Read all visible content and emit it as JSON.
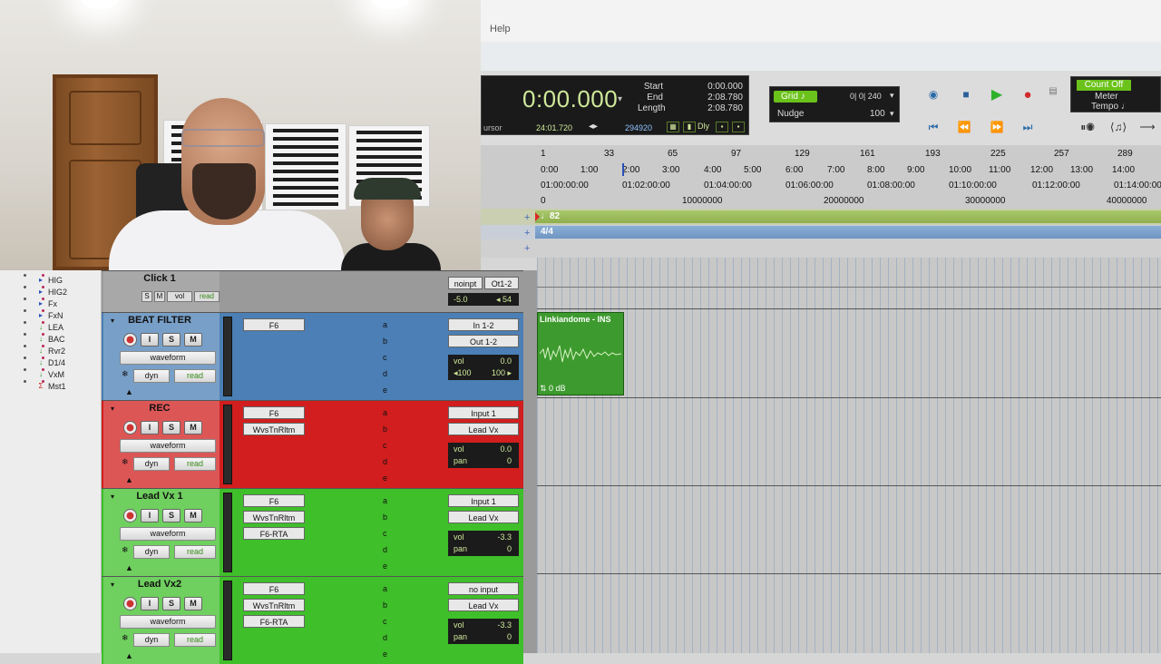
{
  "menu": {
    "help": "Help"
  },
  "counter": {
    "main": "0:00.000",
    "labels": [
      "Start",
      "End",
      "Length"
    ],
    "values": [
      "0:00.000",
      "2:08.780",
      "2:08.780"
    ],
    "cursor_label": "ursor",
    "cursor_value": "24:01.720",
    "samples_value": "294920",
    "dly": "Dly"
  },
  "grid": {
    "grid_label": "Grid",
    "grid_value": "0| 0| 240",
    "nudge_label": "Nudge",
    "nudge_value": "100"
  },
  "countbox": {
    "count_off": "Count Off",
    "meter": "Meter",
    "tempo": "Tempo"
  },
  "rulers": {
    "bars": [
      "1",
      "33",
      "65",
      "97",
      "129",
      "161",
      "193",
      "225",
      "257",
      "289"
    ],
    "minsec": [
      "0:00",
      "1:00",
      "2:00",
      "3:00",
      "4:00",
      "5:00",
      "6:00",
      "7:00",
      "8:00",
      "9:00",
      "10:00",
      "11:00",
      "12:00",
      "13:00",
      "14:00"
    ],
    "timecode": [
      "01:00:00:00",
      "01:02:00:00",
      "01:04:00:00",
      "01:06:00:00",
      "01:08:00:00",
      "01:10:00:00",
      "01:12:00:00",
      "01:14:00:00"
    ],
    "samples": [
      "0",
      "10000000",
      "20000000",
      "30000000",
      "40000000"
    ]
  },
  "tempo": {
    "label": "♩82"
  },
  "meter_ruler": {
    "label": "4/4"
  },
  "tracklist": [
    {
      "sym": "▸",
      "name": "HIG"
    },
    {
      "sym": "▸",
      "name": "HIG2"
    },
    {
      "sym": "▸",
      "name": "Fx"
    },
    {
      "sym": "▸",
      "name": "FxN"
    },
    {
      "sym": "↓",
      "name": "LEA"
    },
    {
      "sym": "↓",
      "name": "BAC"
    },
    {
      "sym": "↓",
      "name": "Rvr2"
    },
    {
      "sym": "↓",
      "name": "D1/4"
    },
    {
      "sym": "↓",
      "name": "VxM"
    },
    {
      "sym": "Σ",
      "name": "Mst1"
    }
  ],
  "tracks": [
    {
      "name": "Click 1",
      "io_top": "noinpt",
      "io_top2": "Ot1-2",
      "vol": "-5.0",
      "pan": "◂ 54"
    },
    {
      "name": "BEAT FILTER",
      "color": "#4b7fb5",
      "view": "waveform",
      "dyn": "dyn",
      "read": "read",
      "insert1": "F6",
      "input": "In 1-2",
      "output": "Out 1-2",
      "vol_label": "vol",
      "vol": "0.0",
      "pan_label": "◂100",
      "pan": "100 ▸"
    },
    {
      "name": "REC",
      "color": "#d21e1e",
      "view": "waveform",
      "dyn": "dyn",
      "read": "read",
      "insert1": "F6",
      "insert2": "WvsTnRltm",
      "input": "Input 1",
      "output": "Lead Vx",
      "vol_label": "vol",
      "vol": "0.0",
      "pan_label": "pan",
      "pan": "0"
    },
    {
      "name": "Lead Vx 1",
      "color": "#3fbf2a",
      "view": "waveform",
      "dyn": "dyn",
      "read": "read",
      "insert1": "F6",
      "insert2": "WvsTnRltm",
      "insert3": "F6-RTA",
      "input": "Input 1",
      "output": "Lead Vx",
      "vol_label": "vol",
      "vol": "-3.3",
      "pan_label": "pan",
      "pan": "0"
    },
    {
      "name": "Lead Vx2",
      "color": "#3fbf2a",
      "view": "waveform",
      "dyn": "dyn",
      "read": "read",
      "insert1": "F6",
      "insert2": "WvsTnRltm",
      "insert3": "F6-RTA",
      "input": "no input",
      "output": "Lead Vx",
      "vol_label": "vol",
      "vol": "-3.3",
      "pan_label": "pan",
      "pan": "0"
    }
  ],
  "sends": [
    "a",
    "b",
    "c",
    "d",
    "e"
  ],
  "clip": {
    "name": "Linkiandome - INS",
    "gain": "0 dB"
  },
  "buttons": {
    "solo": "S",
    "mute": "M",
    "input": "I",
    "vol": "vol",
    "read": "read"
  },
  "colors": {
    "counter_green": "#cfe89a",
    "grid_green": "#6bc21a",
    "track_red": "#d21e1e",
    "track_green": "#3fbf2a",
    "track_blue": "#4b7fb5"
  }
}
